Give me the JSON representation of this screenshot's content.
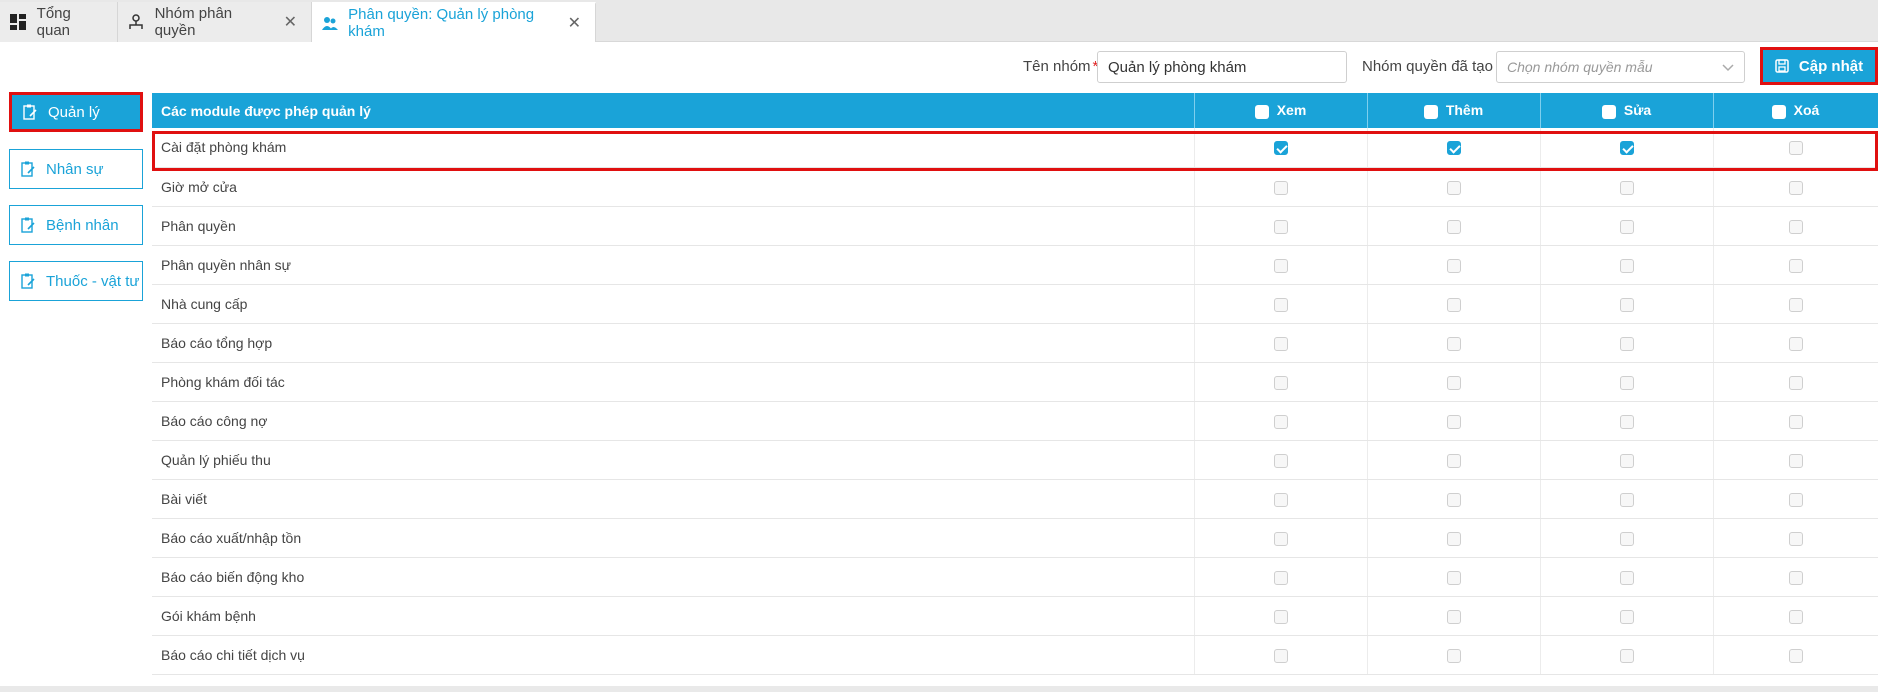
{
  "tabs": [
    {
      "label": "Tổng quan",
      "icon": "dashboard-icon",
      "closable": false
    },
    {
      "label": "Nhóm phân quyền",
      "icon": "org-chart-icon",
      "closable": true
    },
    {
      "label": "Phân quyền: Quản lý phòng khám",
      "icon": "users-icon",
      "closable": true,
      "active": true
    }
  ],
  "toolbar": {
    "group_name_label": "Tên nhóm",
    "group_name_required": "*",
    "group_name_value": "Quản lý phòng khám",
    "template_label": "Nhóm quyền đã tạo :",
    "template_placeholder": "Chọn nhóm quyền mẫu",
    "update_label": "Cập nhật"
  },
  "sidebar": {
    "items": [
      {
        "label": "Quản lý",
        "active": true
      },
      {
        "label": "Nhân sự"
      },
      {
        "label": "Bệnh nhân"
      },
      {
        "label": "Thuốc - vật tư"
      }
    ]
  },
  "table": {
    "headers": {
      "module": "Các module được phép quản lý",
      "view": "Xem",
      "add": "Thêm",
      "edit": "Sửa",
      "delete": "Xoá"
    },
    "rows": [
      {
        "name": "Cài đặt phòng khám",
        "view": true,
        "add": true,
        "edit": true,
        "delete": false
      },
      {
        "name": "Giờ mở cửa",
        "view": false,
        "add": false,
        "edit": false,
        "delete": false
      },
      {
        "name": "Phân quyền",
        "view": false,
        "add": false,
        "edit": false,
        "delete": false
      },
      {
        "name": "Phân quyền nhân sự",
        "view": false,
        "add": false,
        "edit": false,
        "delete": false
      },
      {
        "name": "Nhà cung cấp",
        "view": false,
        "add": false,
        "edit": false,
        "delete": false
      },
      {
        "name": "Báo cáo tổng hợp",
        "view": false,
        "add": false,
        "edit": false,
        "delete": false
      },
      {
        "name": "Phòng khám đối tác",
        "view": false,
        "add": false,
        "edit": false,
        "delete": false
      },
      {
        "name": "Báo cáo công nợ",
        "view": false,
        "add": false,
        "edit": false,
        "delete": false
      },
      {
        "name": "Quản lý phiếu thu",
        "view": false,
        "add": false,
        "edit": false,
        "delete": false
      },
      {
        "name": "Bài viết",
        "view": false,
        "add": false,
        "edit": false,
        "delete": false
      },
      {
        "name": "Báo cáo xuất/nhập tồn",
        "view": false,
        "add": false,
        "edit": false,
        "delete": false
      },
      {
        "name": "Báo cáo biến động kho",
        "view": false,
        "add": false,
        "edit": false,
        "delete": false
      },
      {
        "name": "Gói khám bệnh",
        "view": false,
        "add": false,
        "edit": false,
        "delete": false
      },
      {
        "name": "Báo cáo chi tiết dịch vụ",
        "view": false,
        "add": false,
        "edit": false,
        "delete": false
      }
    ]
  },
  "colors": {
    "accent": "#1aa3d8",
    "highlight": "#e01010"
  }
}
